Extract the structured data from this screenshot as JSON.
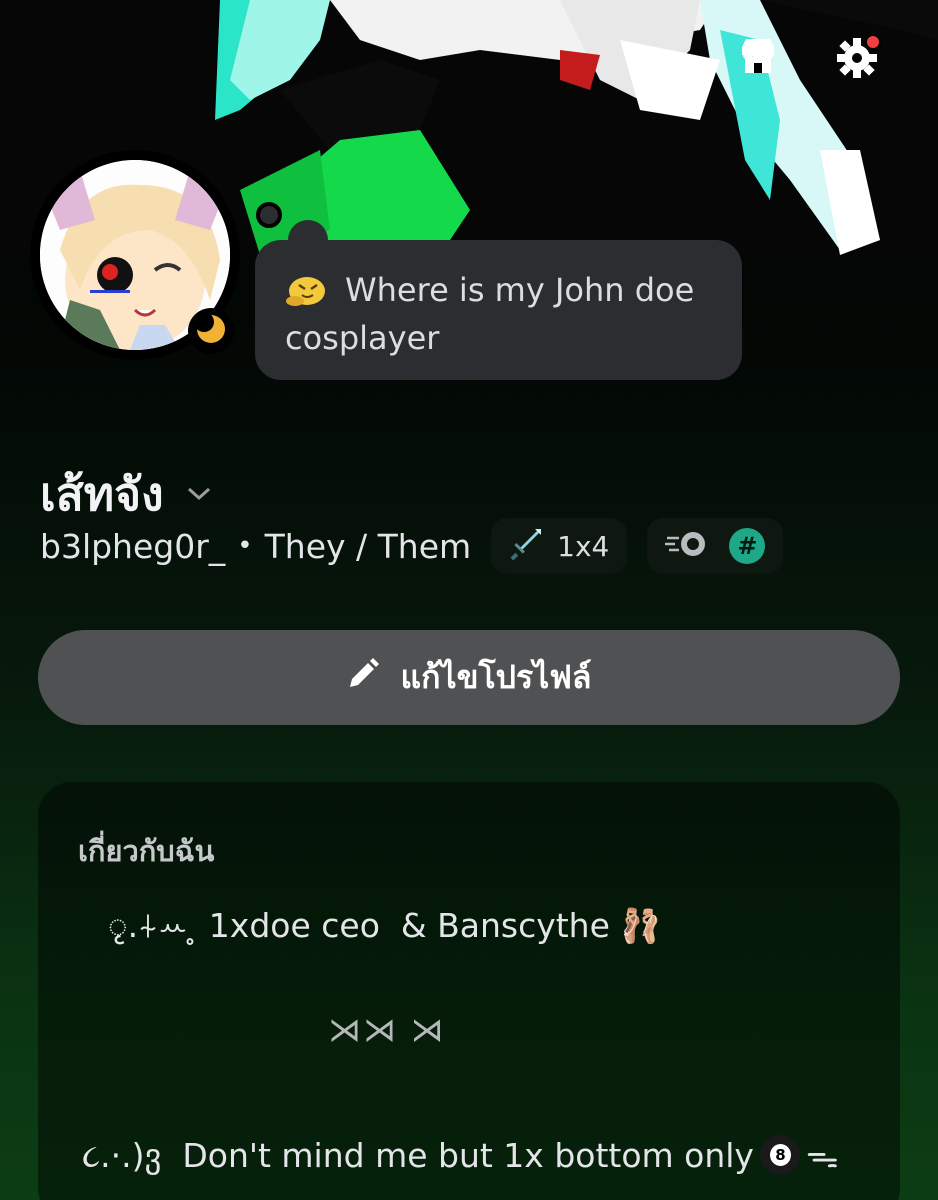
{
  "header": {
    "shop_icon": "shop-icon",
    "settings_icon": "gear-icon",
    "settings_has_notification": true
  },
  "profile": {
    "display_name": "เส้ทจัง",
    "username": "b3lpheg0r_",
    "separator": "•",
    "pronouns": "They / Them",
    "status_icon": "moon-idle-icon",
    "custom_status": {
      "emoji": "blob-emoji",
      "text": "Where is my John doe cosplayer"
    },
    "clan_tag": "1x4",
    "clan_icon": "sword-icon",
    "badges": [
      "nitro-icon",
      "hashtag-badge"
    ]
  },
  "actions": {
    "edit_profile_label": "แก้ไขโปรไฟล์",
    "edit_icon": "pencil-icon"
  },
  "about": {
    "title": "เกี่ยวกับฉัน",
    "lines": [
      "ृ.⍭ꕀ ̥ 1xdoe ceo  & Banscythe 🩰",
      "⋊⋊ ⋊",
      "૮.·.)ვ  Don't mind me but 1x bottom only"
    ],
    "line3_suffix": "ᯓ"
  },
  "colors": {
    "bubble_bg": "#2b2d31",
    "button_bg": "#505153",
    "hash_badge": "#1ea887",
    "moon": "#f0b232"
  }
}
